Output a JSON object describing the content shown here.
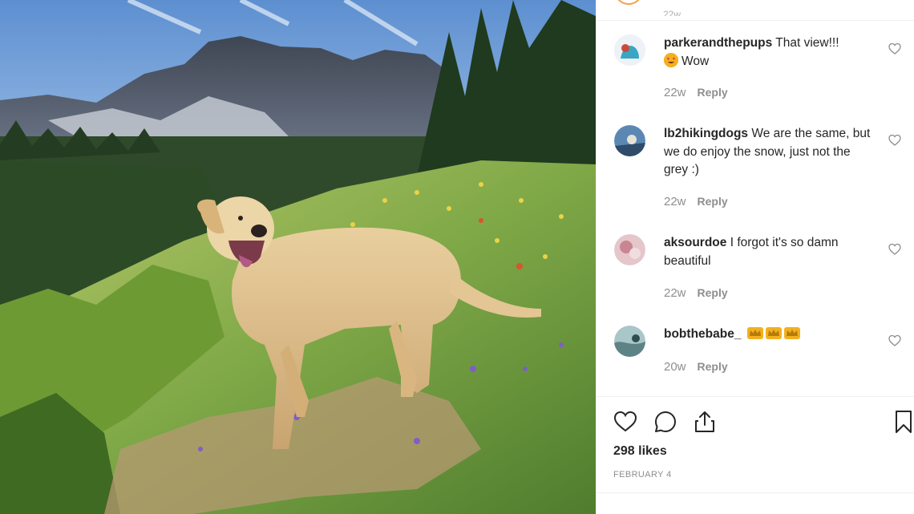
{
  "post": {
    "image_alt": "Yellow labrador standing on a flowered mountain slope",
    "top_cut_time": "22w"
  },
  "comments": [
    {
      "username": "parkerandthepups",
      "text": "That view!!!",
      "text2": "Wow",
      "time": "22w",
      "reply_label": "Reply",
      "avatar_color": "#cfd8e3"
    },
    {
      "username": "lb2hikingdogs",
      "text": "We are the same, but we do enjoy the snow, just not the grey :)",
      "time": "22w",
      "reply_label": "Reply",
      "avatar_color": "#5b88b3"
    },
    {
      "username": "aksourdoe",
      "text": "I forgot it's so damn beautiful",
      "time": "22w",
      "reply_label": "Reply",
      "avatar_color": "#d9a7b0"
    },
    {
      "username": "bobthebabe_",
      "text": "",
      "time": "20w",
      "reply_label": "Reply",
      "avatar_color": "#7ea2a6"
    }
  ],
  "actions": {
    "likes": "298 likes",
    "date": "FEBRUARY 4"
  },
  "colors": {
    "text": "#262626",
    "meta": "#8e8e8e",
    "divider": "#efefef",
    "emoji": "#f2b020"
  },
  "icons": [
    "heart-icon",
    "comment-icon",
    "share-icon",
    "bookmark-icon"
  ]
}
